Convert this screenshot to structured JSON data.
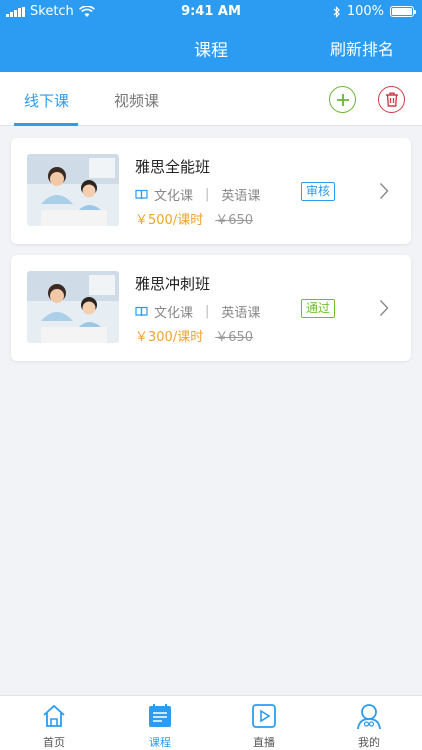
{
  "status": {
    "carrier": "Sketch",
    "time": "9:41 AM",
    "battery": "100%"
  },
  "nav": {
    "title": "课程",
    "action_label": "刷新排名"
  },
  "tabs": [
    {
      "label": "线下课",
      "active": true
    },
    {
      "label": "视频课",
      "active": false
    }
  ],
  "courses": [
    {
      "title": "雅思全能班",
      "category": "文化课",
      "subject": "英语课",
      "price": "￥500/课时",
      "original_price": "￥650",
      "status": "审核"
    },
    {
      "title": "雅思冲刺班",
      "category": "文化课",
      "subject": "英语课",
      "price": "￥300/课时",
      "original_price": "￥650",
      "status": "通过"
    }
  ],
  "bottom_nav": [
    {
      "label": "首页",
      "icon": "home-icon"
    },
    {
      "label": "课程",
      "icon": "course-icon",
      "active": true
    },
    {
      "label": "直播",
      "icon": "live-play-icon"
    },
    {
      "label": "我的",
      "icon": "profile-icon"
    }
  ],
  "colors": {
    "primary": "#2b9cf2",
    "add_green": "#62b92e",
    "delete_red": "#d33a48",
    "price_orange": "#f4a32b",
    "badge_pass_green": "#6cbf2e",
    "background": "#f2f3f7"
  }
}
